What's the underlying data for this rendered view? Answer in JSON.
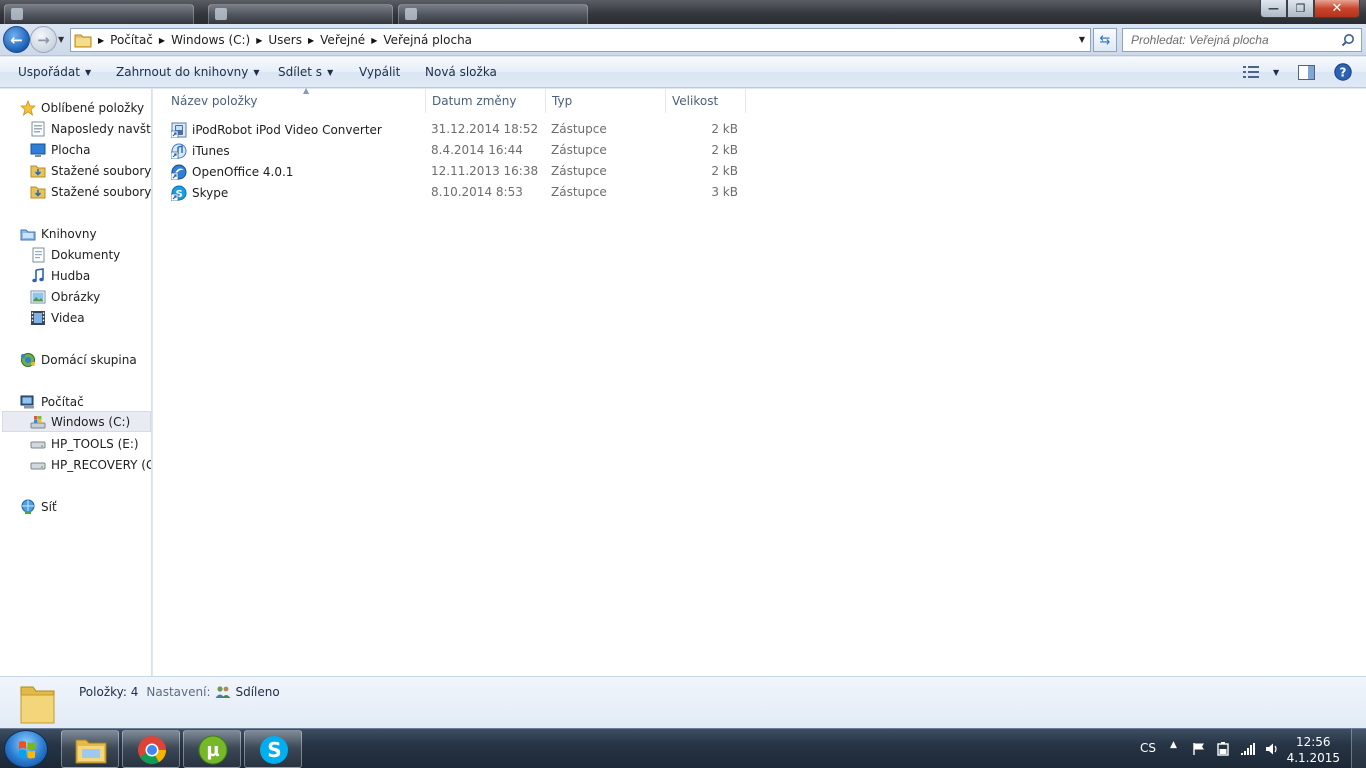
{
  "window": {
    "minimize_glyph": "—",
    "maximize_glyph": "❐",
    "close_glyph": "✕"
  },
  "address": {
    "crumbs": [
      "Počítač",
      "Windows (C:)",
      "Users",
      "Veřejné",
      "Veřejná plocha"
    ]
  },
  "search": {
    "placeholder": "Prohledat: Veřejná plocha"
  },
  "toolbar": {
    "organize": "Uspořádat",
    "include_library": "Zahrnout do knihovny",
    "share": "Sdílet s",
    "burn": "Vypálit",
    "new_folder": "Nová složka"
  },
  "sidebar": {
    "favorites": {
      "label": "Oblíbené položky",
      "items": [
        "Naposledy navštívené",
        "Plocha",
        "Stažené soubory",
        "Stažené soubory"
      ]
    },
    "libraries": {
      "label": "Knihovny",
      "items": [
        "Dokumenty",
        "Hudba",
        "Obrázky",
        "Videa"
      ]
    },
    "homegroup": {
      "label": "Domácí skupina"
    },
    "computer": {
      "label": "Počítač",
      "items": [
        "Windows (C:)",
        "HP_TOOLS (E:)",
        "HP_RECOVERY (G:)"
      ]
    },
    "network": {
      "label": "Síť"
    }
  },
  "columns": [
    "Název položky",
    "Datum změny",
    "Typ",
    "Velikost"
  ],
  "files": [
    {
      "name": "iPodRobot iPod Video Converter",
      "date": "31.12.2014 18:52",
      "type": "Zástupce",
      "size": "2 kB",
      "icon": "ipodrobot-shortcut-icon"
    },
    {
      "name": "iTunes",
      "date": "8.4.2014 16:44",
      "type": "Zástupce",
      "size": "2 kB",
      "icon": "itunes-shortcut-icon"
    },
    {
      "name": "OpenOffice 4.0.1",
      "date": "12.11.2013 16:38",
      "type": "Zástupce",
      "size": "2 kB",
      "icon": "openoffice-shortcut-icon"
    },
    {
      "name": "Skype",
      "date": "8.10.2014 8:53",
      "type": "Zástupce",
      "size": "3 kB",
      "icon": "skype-shortcut-icon"
    }
  ],
  "details": {
    "count_label": "Položky: 4",
    "settings_label": "Nastavení:",
    "settings_value": "Sdíleno"
  },
  "taskbar": {
    "apps": [
      "explorer-icon",
      "chrome-icon",
      "utorrent-icon",
      "skype-icon"
    ],
    "language": "CS",
    "time": "12:56",
    "date": "4.1.2015"
  },
  "colors": {
    "accent": "#1b5fb4",
    "selection": "#e8ecf2",
    "meta_text": "#6d6d6d"
  }
}
